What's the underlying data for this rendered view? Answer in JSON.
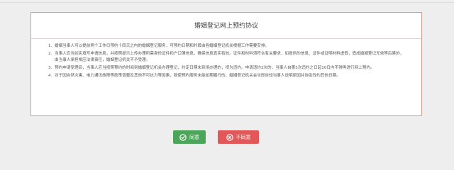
{
  "agreement": {
    "title": "婚姻登记网上预约协议",
    "terms": [
      {
        "number": "1.",
        "text": "婚姻当事人可以提前两个工作日预约十四天之内的婚姻登记服务，可预约日期和时段由各婚姻登记机关根据工作需要安排。"
      },
      {
        "number": "2.",
        "text": "当事人应当如实填写申请信息，并按照提示上传办理所需身份证件和户口簿信息，确保信息真实有效。证件和材料须符合有关要求，如提供的信息、证件或证明材料虚假，造成婚姻登记无效等后果的，由当事人承担相应法律责任，婚姻登记机关不予受理。"
      },
      {
        "number": "3.",
        "text": "预约申请受理后，当事人应当按照预约的时间到婚姻登记机关办理登记，约定日期未到场办理的，视为违约。申请违约3次的，当事人自第3次违约之日起10日内不得再进行网上预约。"
      },
      {
        "number": "4.",
        "text": "对于因自然灾害、电力通讯故障等政策调整及其他不可抗力等因素，致使预约服务未能如期履行的，婚姻登记机关会当即告知当事人说明原因并协助改约其他日期。"
      }
    ]
  },
  "actions": {
    "agree_label": "同意",
    "disagree_label": "不同意"
  },
  "icons": {
    "agree": "check-circle-icon",
    "disagree": "close-circle-icon"
  },
  "colors": {
    "page_background": "#eeeeee",
    "card_border": "#d79a8c",
    "agree_button": "#4ca65a",
    "disagree_button": "#e25757",
    "button_text": "#ffffff"
  }
}
